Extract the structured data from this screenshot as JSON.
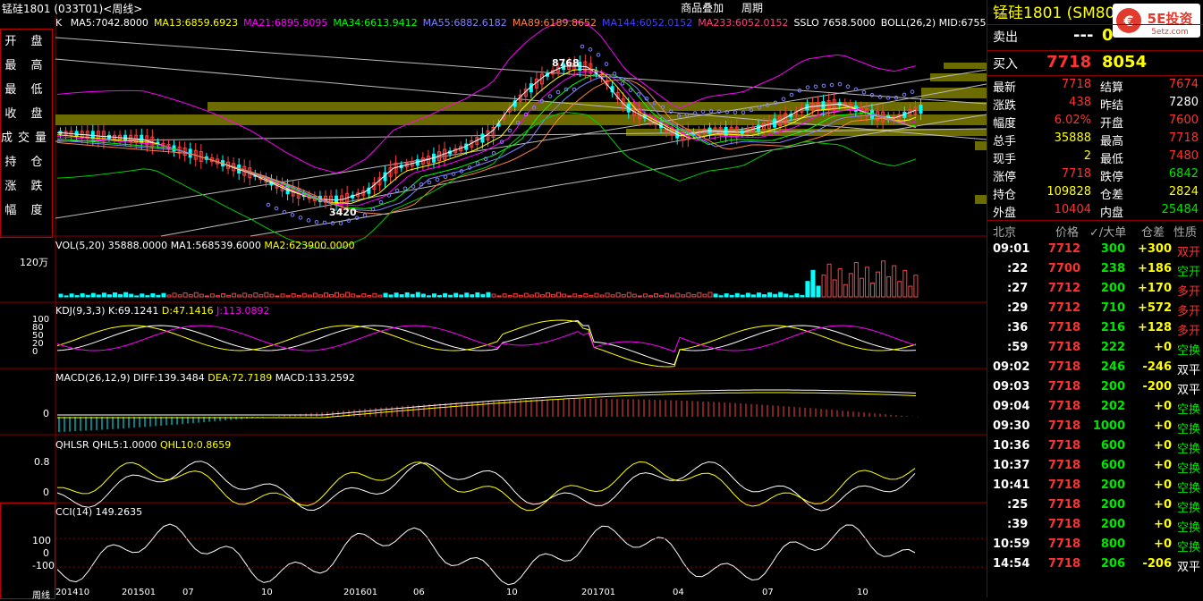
{
  "window": {
    "title": "锰硅1801 (033T01)<周线>"
  },
  "menus": [
    "商品叠加",
    "周期"
  ],
  "left_panel": [
    "开 盘",
    "最 高",
    "最 低",
    "收 盘",
    "成交量",
    "持 仓",
    "涨 跌",
    "幅 度"
  ],
  "main_chart": {
    "label": "K",
    "ma": [
      {
        "text": "MA5:7042.8000",
        "color": "#ffffff"
      },
      {
        "text": "MA13:6859.6923",
        "color": "#ffff00"
      },
      {
        "text": "MA21:6895.8095",
        "color": "#ff00ff"
      },
      {
        "text": "MA34:6613.9412",
        "color": "#00ff00"
      },
      {
        "text": "MA55:6882.6182",
        "color": "#8080ff"
      },
      {
        "text": "MA89:6189.8652",
        "color": "#ff8040"
      },
      {
        "text": "MA144:6052.0152",
        "color": "#4040ff"
      },
      {
        "text": "MA233:6052.0152",
        "color": "#ff4080"
      },
      {
        "text": "SSLO 7658.5000",
        "color": "#ffffff"
      },
      {
        "text": "BOLL(26,2) MID:6755",
        "color": "#ffffff"
      }
    ],
    "high_label": "8768",
    "low_label": "3420"
  },
  "vol": {
    "label": "VOL(5,20) 35888.0000",
    "ma1": "MA1:568539.6000",
    "ma2": "MA2:623900.0000",
    "yaxis": "120万"
  },
  "kdj": {
    "label": "KDJ(9,3,3)",
    "k": "K:69.1241",
    "d": "D:47.1416",
    "j": "J:113.0892",
    "yticks": [
      "100",
      "80",
      "50",
      "20",
      "0"
    ]
  },
  "macd": {
    "label": "MACD(26,12,9)",
    "diff": "DIFF:139.3484",
    "dea": "DEA:72.7189",
    "macd": "MACD:133.2592",
    "ytick": "0"
  },
  "qhlsr": {
    "label": "QHLSR",
    "q5": "QHL5:1.0000",
    "q10": "QHL10:0.8659",
    "yticks": [
      "0.8",
      "0"
    ]
  },
  "cci": {
    "label": "CCI(14) 149.2635",
    "yticks": [
      "100",
      "0",
      "-100"
    ]
  },
  "xaxis": {
    "label": "周线",
    "ticks": [
      "201410",
      "201501",
      "07",
      "10",
      "201601",
      "06",
      "10",
      "201701",
      "04",
      "07",
      "10"
    ]
  },
  "right_panel": {
    "title": "锰硅1801 (SM801)",
    "sell": {
      "label": "卖出",
      "price": "---",
      "vol": "0"
    },
    "buy": {
      "label": "买入",
      "price": "7718",
      "vol": "8054"
    },
    "stats": [
      {
        "l": "最新",
        "lv": "7718",
        "lc": "red",
        "r": "结算",
        "rv": "7674",
        "rc": "red"
      },
      {
        "l": "涨跌",
        "lv": "438",
        "lc": "red",
        "r": "昨结",
        "rv": "7280",
        "rc": "white"
      },
      {
        "l": "幅度",
        "lv": "6.02%",
        "lc": "red",
        "r": "开盘",
        "rv": "7600",
        "rc": "red"
      },
      {
        "l": "总手",
        "lv": "35888",
        "lc": "yellow",
        "r": "最高",
        "rv": "7718",
        "rc": "red"
      },
      {
        "l": "现手",
        "lv": "2",
        "lc": "yellow",
        "r": "最低",
        "rv": "7480",
        "rc": "red"
      },
      {
        "l": "涨停",
        "lv": "7718",
        "lc": "red",
        "r": "跌停",
        "rv": "6842",
        "rc": "green"
      },
      {
        "l": "持仓",
        "lv": "109828",
        "lc": "yellow",
        "r": "仓差",
        "rv": "2824",
        "rc": "yellow"
      },
      {
        "l": "外盘",
        "lv": "10404",
        "lc": "red",
        "r": "内盘",
        "rv": "25484",
        "rc": "green"
      }
    ],
    "ticks_header": [
      "北京",
      "价格",
      "✓/大单",
      "仓差",
      "性质"
    ],
    "ticks": [
      {
        "t": "09:01",
        "p": "7712",
        "v": "300",
        "d": "+300",
        "n": "双开",
        "nc": "red"
      },
      {
        "t": ":22",
        "p": "7700",
        "v": "238",
        "d": "+186",
        "n": "空开",
        "nc": "green"
      },
      {
        "t": ":27",
        "p": "7712",
        "v": "200",
        "d": "+170",
        "n": "多开",
        "nc": "red"
      },
      {
        "t": ":29",
        "p": "7712",
        "v": "710",
        "d": "+572",
        "n": "多开",
        "nc": "red"
      },
      {
        "t": ":36",
        "p": "7718",
        "v": "216",
        "d": "+128",
        "n": "多开",
        "nc": "red"
      },
      {
        "t": ":59",
        "p": "7718",
        "v": "222",
        "d": "+0",
        "n": "空换",
        "nc": "green"
      },
      {
        "t": "09:02",
        "p": "7718",
        "v": "246",
        "d": "-246",
        "n": "双平",
        "nc": "white"
      },
      {
        "t": "09:03",
        "p": "7718",
        "v": "200",
        "d": "-200",
        "n": "双平",
        "nc": "white"
      },
      {
        "t": "09:04",
        "p": "7718",
        "v": "202",
        "d": "+0",
        "n": "空换",
        "nc": "green"
      },
      {
        "t": "09:30",
        "p": "7718",
        "v": "1000",
        "d": "+0",
        "n": "空换",
        "nc": "green"
      },
      {
        "t": "10:36",
        "p": "7718",
        "v": "600",
        "d": "+0",
        "n": "空换",
        "nc": "green"
      },
      {
        "t": "10:37",
        "p": "7718",
        "v": "600",
        "d": "+0",
        "n": "空换",
        "nc": "green"
      },
      {
        "t": "10:41",
        "p": "7718",
        "v": "200",
        "d": "+0",
        "n": "空换",
        "nc": "green"
      },
      {
        "t": ":25",
        "p": "7718",
        "v": "200",
        "d": "+0",
        "n": "空换",
        "nc": "green"
      },
      {
        "t": ":39",
        "p": "7718",
        "v": "200",
        "d": "+0",
        "n": "空换",
        "nc": "green"
      },
      {
        "t": "10:59",
        "p": "7718",
        "v": "800",
        "d": "+0",
        "n": "空换",
        "nc": "green"
      },
      {
        "t": "14:54",
        "p": "7718",
        "v": "206",
        "d": "-206",
        "n": "双平",
        "nc": "white"
      }
    ]
  }
}
